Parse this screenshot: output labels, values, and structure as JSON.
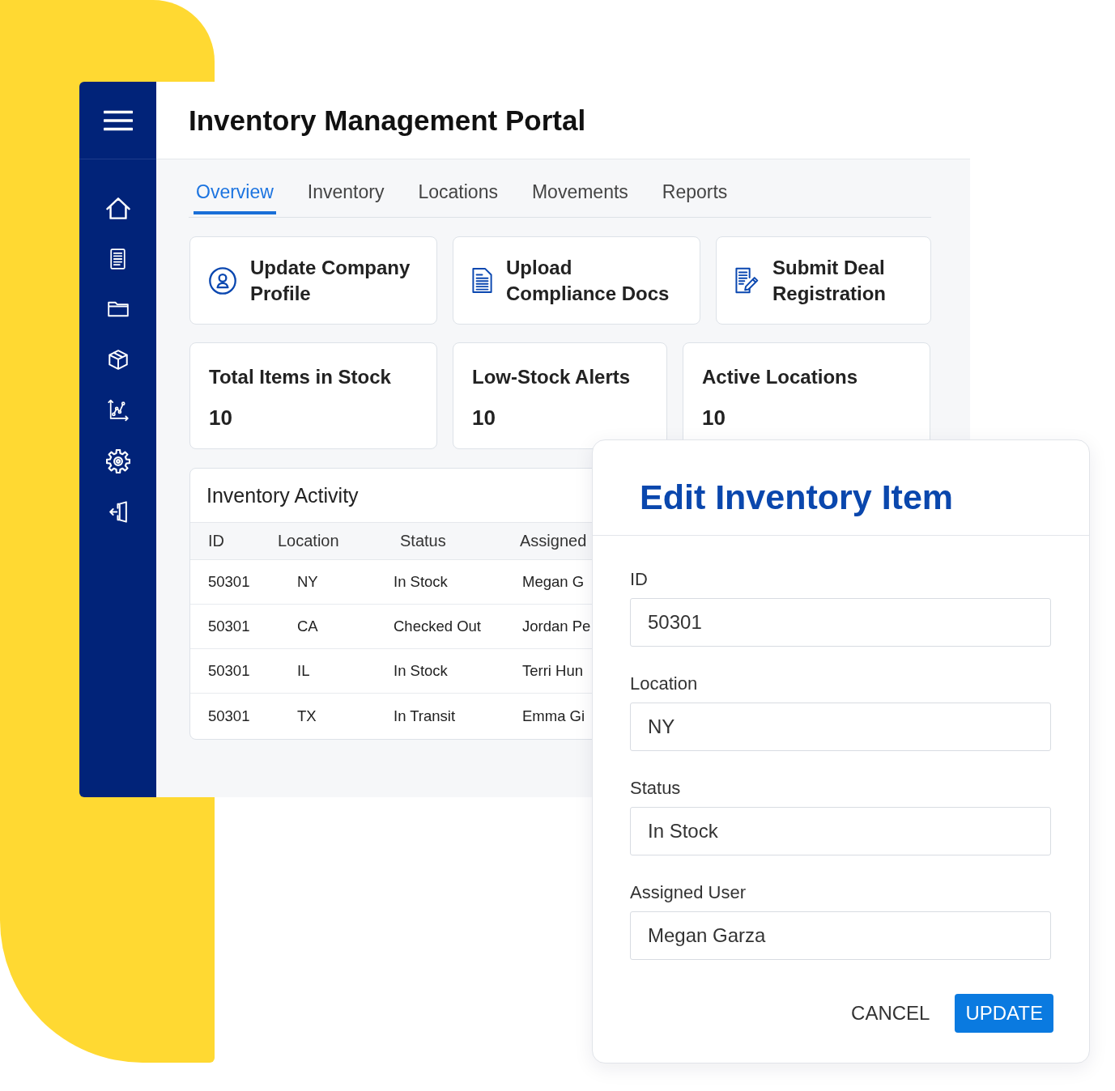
{
  "window": {
    "title": "Inventory Management Portal"
  },
  "tabs": [
    {
      "label": "Overview",
      "selected": true
    },
    {
      "label": "Inventory",
      "selected": false
    },
    {
      "label": "Locations",
      "selected": false
    },
    {
      "label": "Movements",
      "selected": false
    },
    {
      "label": "Reports",
      "selected": false
    }
  ],
  "action_cards": [
    {
      "label": "Update Company Profile"
    },
    {
      "label": "Upload Compliance Docs"
    },
    {
      "label": "Submit Deal Registration"
    }
  ],
  "stat_cards": [
    {
      "title": "Total Items in Stock",
      "value": "10"
    },
    {
      "title": "Low-Stock Alerts",
      "value": "10"
    },
    {
      "title": "Active Locations",
      "value": "10"
    }
  ],
  "activity": {
    "title": "Inventory Activity",
    "columns": [
      "ID",
      "Location",
      "Status",
      "Assigned"
    ],
    "rows": [
      [
        "50301",
        "NY",
        "In Stock",
        "Megan G"
      ],
      [
        "50301",
        "CA",
        "Checked Out",
        "Jordan Pe"
      ],
      [
        "50301",
        "IL",
        "In Stock",
        "Terri Hun"
      ],
      [
        "50301",
        "TX",
        "In Transit",
        "Emma Gi"
      ]
    ]
  },
  "dialog": {
    "title": "Edit Inventory Item",
    "fields": [
      {
        "label": "ID",
        "value": "50301"
      },
      {
        "label": "Location",
        "value": "NY"
      },
      {
        "label": "Status",
        "value": "In Stock"
      },
      {
        "label": "Assigned User",
        "value": "Megan Garza"
      }
    ],
    "buttons": [
      {
        "label": "CANCEL",
        "kind": "text"
      },
      {
        "label": "UPDATE",
        "kind": "primary"
      }
    ]
  }
}
